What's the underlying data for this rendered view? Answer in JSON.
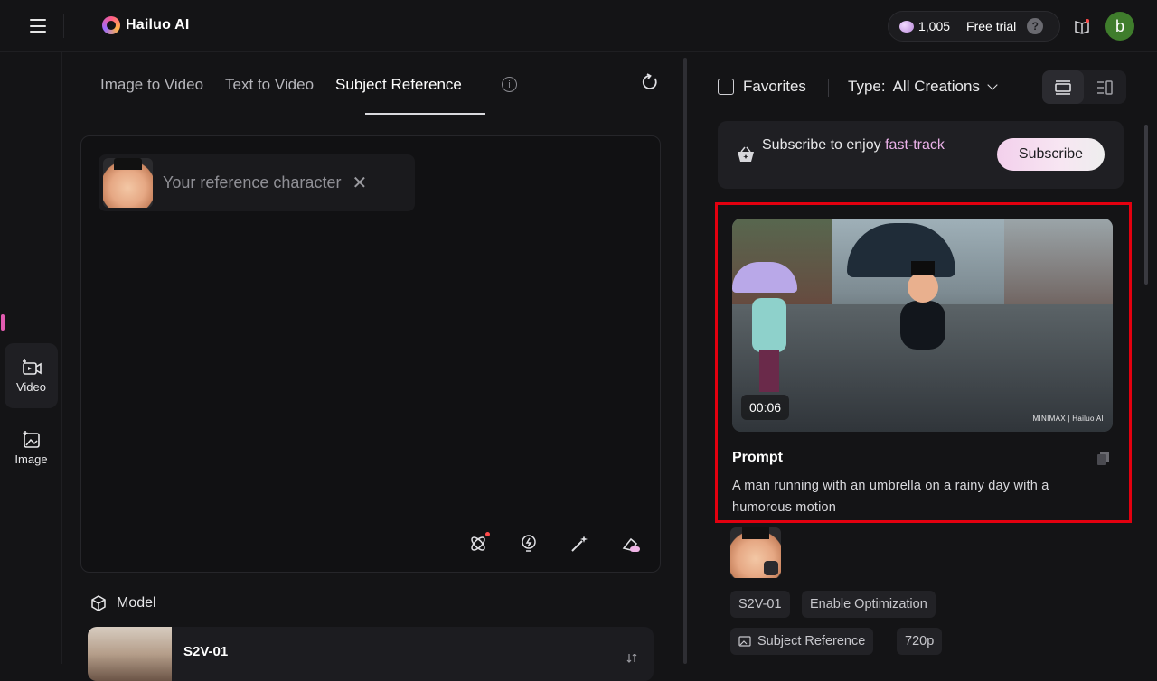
{
  "header": {
    "brand": "Hailuo AI",
    "credits": "1,005",
    "trial_label": "Free trial",
    "help_glyph": "?",
    "avatar_initial": "b"
  },
  "sidebar": {
    "items": [
      {
        "label": "Video",
        "icon": "video-icon",
        "active": true
      },
      {
        "label": "Image",
        "icon": "image-icon",
        "active": false
      }
    ]
  },
  "main": {
    "tabs": [
      {
        "label": "Image to Video",
        "active": false
      },
      {
        "label": "Text to Video",
        "active": false
      },
      {
        "label": "Subject Reference",
        "active": true
      }
    ],
    "info_glyph": "i",
    "reference_chip": {
      "label": "Your reference character",
      "close_glyph": "✕"
    },
    "tools": [
      "sparkle-icon",
      "lightbulb-icon",
      "magic-wand-icon",
      "eraser-icon"
    ],
    "model_section": {
      "title": "Model",
      "model_name": "S2V-01"
    }
  },
  "results": {
    "favorites_label": "Favorites",
    "type_label": "Type:",
    "type_value": "All Creations",
    "subscribe": {
      "text_prefix": "Subscribe to enjoy",
      "text_highlight": "fast-track",
      "button_label": "Subscribe"
    },
    "card": {
      "duration": "00:06",
      "watermark": "MINIMAX | Hailuo AI",
      "prompt_title": "Prompt",
      "prompt_text": "A man running with an umbrella on a rainy day with a humorous motion",
      "chips": [
        "S2V-01",
        "Enable Optimization",
        "Subject Reference",
        "720p"
      ]
    }
  },
  "colors": {
    "accent_pink": "#e25bb0",
    "highlight_box": "#e3000f",
    "background": "#141416"
  }
}
